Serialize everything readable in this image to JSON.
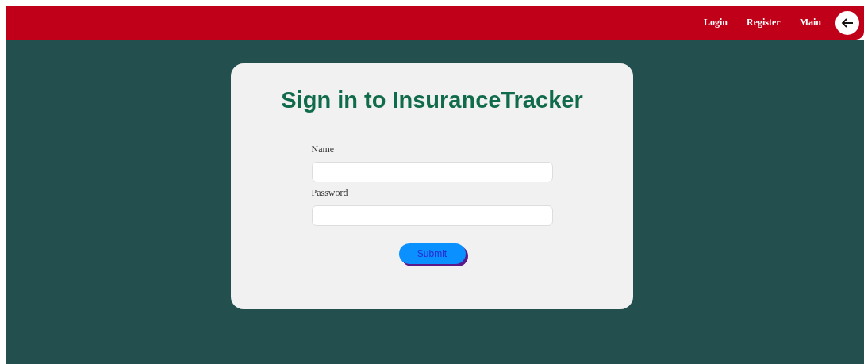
{
  "nav": {
    "links": [
      "Login",
      "Register",
      "Main"
    ]
  },
  "form": {
    "title": "Sign in to InsuranceTracker",
    "fields": [
      {
        "label": "Name"
      },
      {
        "label": "Password"
      }
    ],
    "submit": "Submit"
  }
}
